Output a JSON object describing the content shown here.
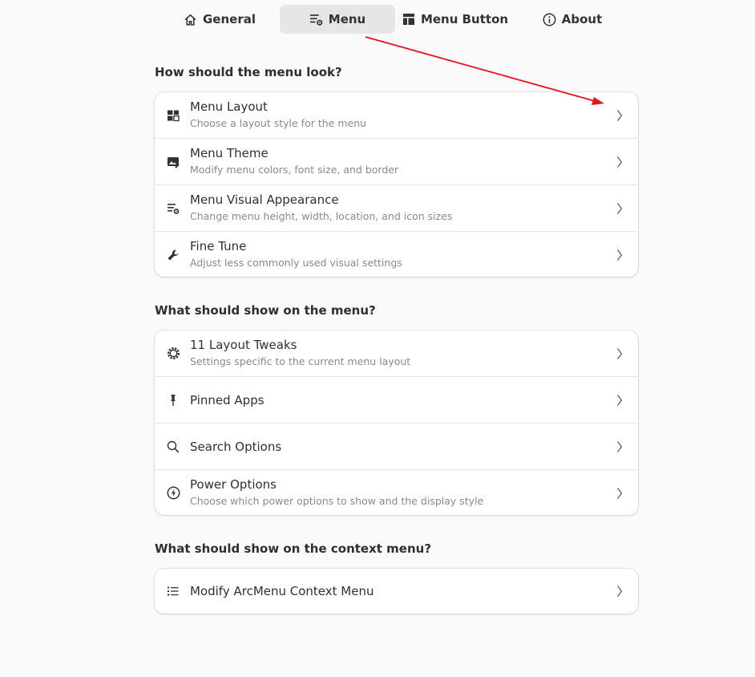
{
  "tabs": [
    {
      "label": "General",
      "icon": "home-icon",
      "active": false
    },
    {
      "label": "Menu",
      "icon": "menu-settings-icon",
      "active": true
    },
    {
      "label": "Menu Button",
      "icon": "menu-button-icon",
      "active": false
    },
    {
      "label": "About",
      "icon": "info-icon",
      "active": false
    }
  ],
  "sections": [
    {
      "title": "How should the menu look?",
      "rows": [
        {
          "title": "Menu Layout",
          "subtitle": "Choose a layout style for the menu",
          "icon": "layout-icon"
        },
        {
          "title": "Menu Theme",
          "subtitle": "Modify menu colors, font size, and border",
          "icon": "theme-icon"
        },
        {
          "title": "Menu Visual Appearance",
          "subtitle": "Change menu height, width, location, and icon sizes",
          "icon": "appearance-icon"
        },
        {
          "title": "Fine Tune",
          "subtitle": "Adjust less commonly used visual settings",
          "icon": "wrench-icon"
        }
      ]
    },
    {
      "title": "What should show on the menu?",
      "rows": [
        {
          "title": "11 Layout Tweaks",
          "subtitle": "Settings specific to the current menu layout",
          "icon": "gear-icon"
        },
        {
          "title": "Pinned Apps",
          "subtitle": "",
          "icon": "pin-icon"
        },
        {
          "title": "Search Options",
          "subtitle": "",
          "icon": "search-icon"
        },
        {
          "title": "Power Options",
          "subtitle": "Choose which power options to show and the display style",
          "icon": "power-icon"
        }
      ]
    },
    {
      "title": "What should show on the context menu?",
      "rows": [
        {
          "title": "Modify ArcMenu Context Menu",
          "subtitle": "",
          "icon": "list-icon"
        }
      ]
    }
  ],
  "colors": {
    "background": "#fafafa",
    "card": "#ffffff",
    "active_tab": "#e6e6e6",
    "annotation_arrow": "#e8121b"
  }
}
